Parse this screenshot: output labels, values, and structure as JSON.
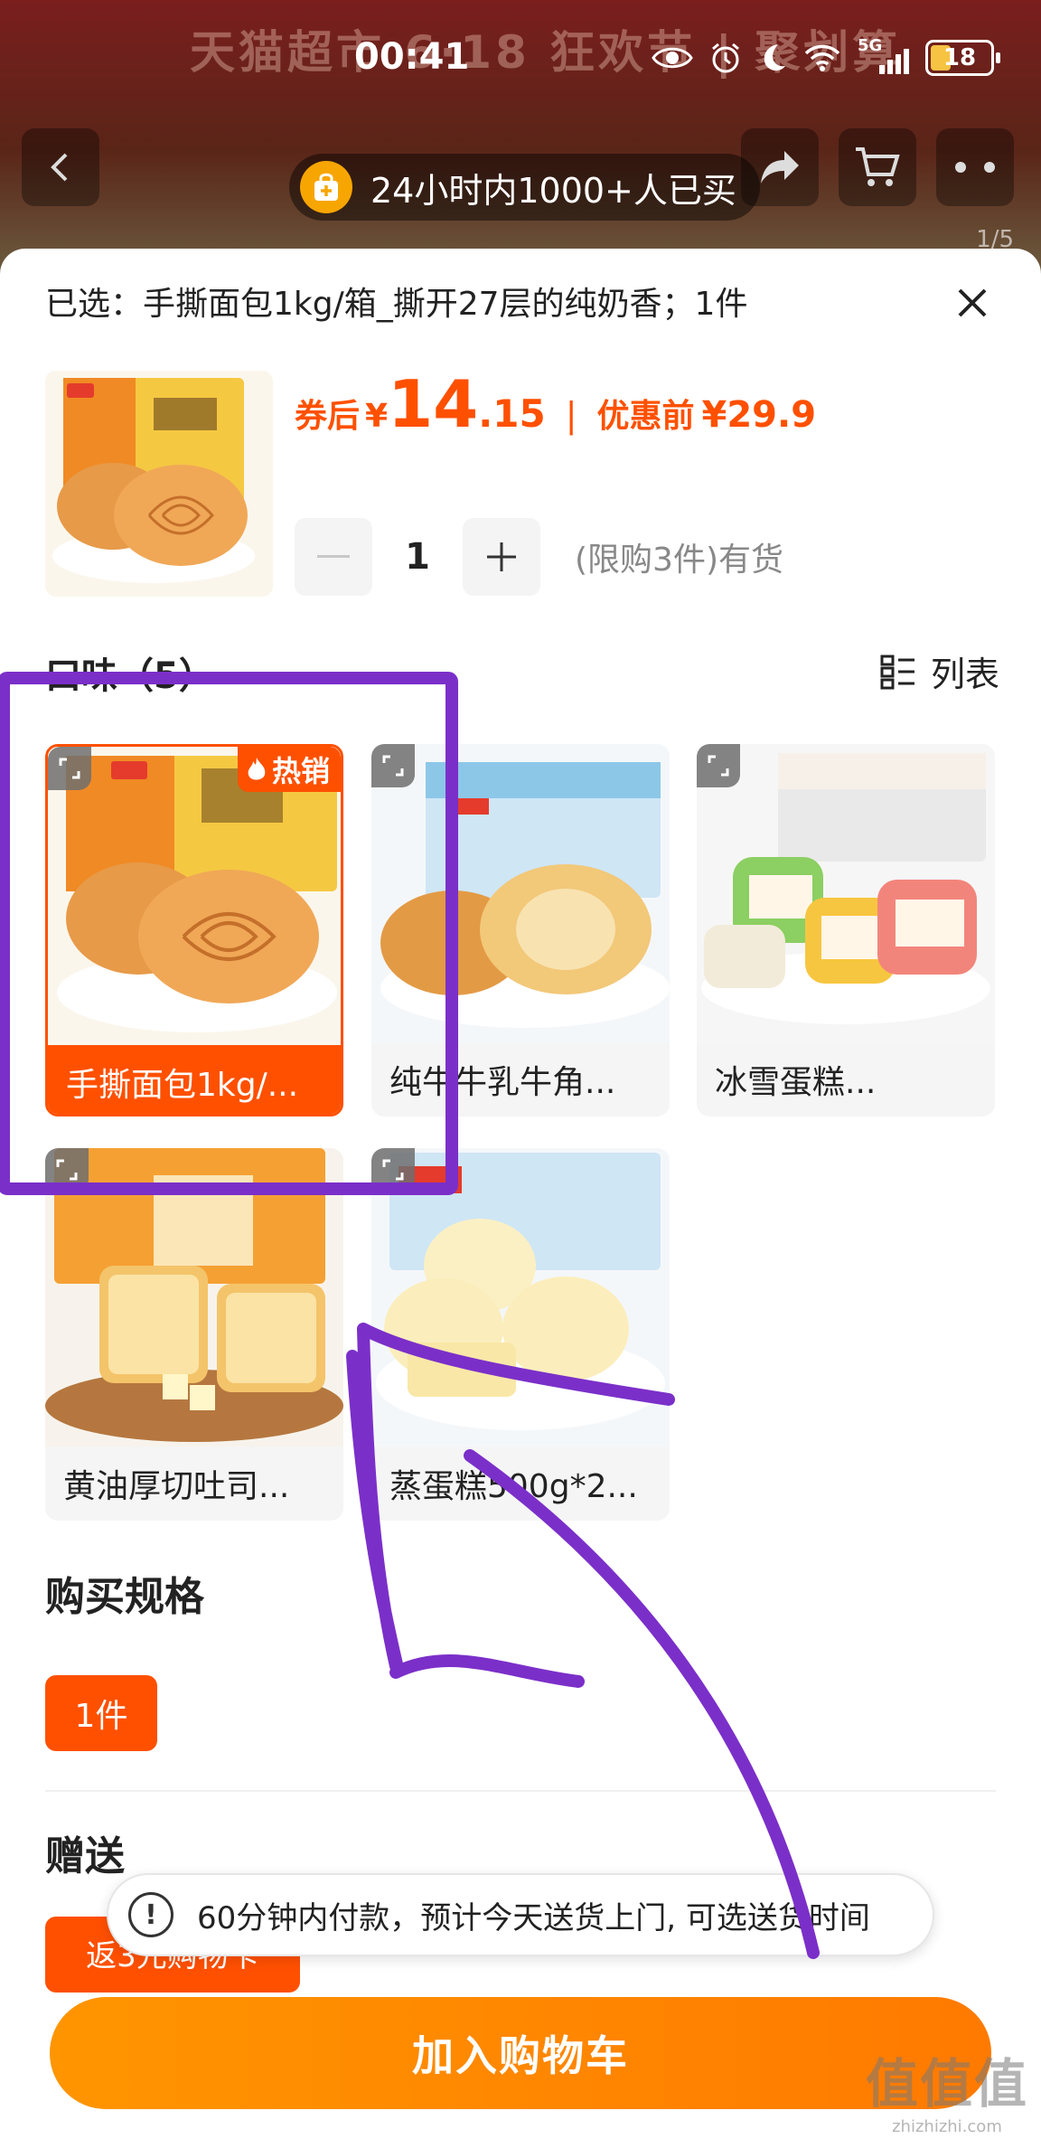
{
  "status_bar": {
    "time": "00:41",
    "network": "5G",
    "battery": "18"
  },
  "background": {
    "banner_text": "天猫超市 6·18 狂欢节 | 聚划算",
    "image_counter": "1/5"
  },
  "buy_notice": {
    "text": "24小时内1000+人已买"
  },
  "sheet": {
    "selected_text": "已选：手撕面包1kg/箱_撕开27层的纯奶香；1件",
    "price": {
      "label": "券后",
      "currency": "¥",
      "integer": "14",
      "decimal": ".15",
      "separator": "|",
      "original_label": "优惠前",
      "original_price": "¥29.9"
    },
    "quantity": {
      "minus": "—",
      "value": "1",
      "plus": "+",
      "note": "(限购3件)有货"
    },
    "flavor_section": {
      "title": "口味（5）",
      "list_toggle_label": "列表"
    },
    "products": [
      {
        "label": "手撕面包1kg/...",
        "selected": true,
        "badge": "热销"
      },
      {
        "label": "纯牛牛乳牛角...",
        "selected": false
      },
      {
        "label": "冰雪蛋糕...",
        "selected": false
      },
      {
        "label": "黄油厚切吐司...",
        "selected": false
      },
      {
        "label": "蒸蛋糕500g*2...",
        "selected": false
      }
    ],
    "spec_section": {
      "title": "购买规格",
      "chip": "1件"
    },
    "gift_section": {
      "title": "赠送",
      "chip": "返3元购物卡"
    },
    "toast": {
      "icon": "!",
      "text": "60分钟内付款，预计今天送货上门, 可选送货时间"
    },
    "add_to_cart": "加入购物车"
  },
  "watermark": {
    "main": "值值值",
    "sub": "zhizhizhi.com"
  },
  "colors": {
    "accent": "#ff5000",
    "button": "#ff8a00",
    "annotation": "#7b2fc9"
  }
}
